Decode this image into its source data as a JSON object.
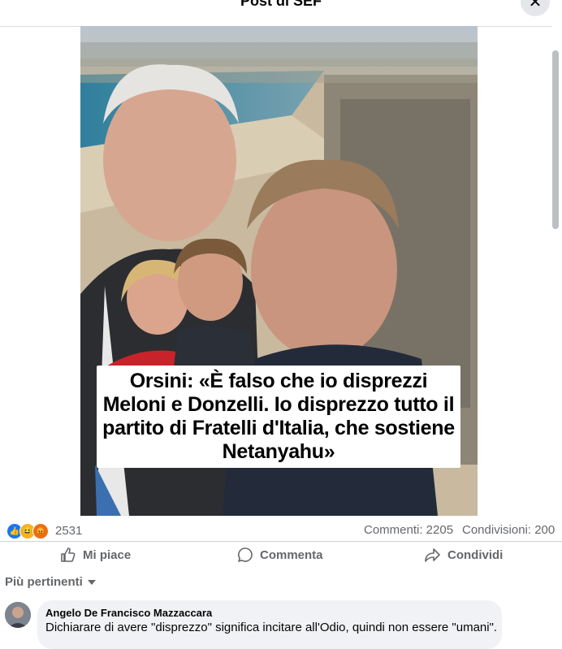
{
  "header": {
    "title": "Post di SEF"
  },
  "post": {
    "headline": "Orsini: «È falso che io disprezzi Meloni e Donzelli. Io disprezzo tutto il partito di Fratelli d'Italia, che sostiene Netanyahu»",
    "reactions": {
      "icons": [
        "like-icon",
        "haha-icon",
        "angry-icon"
      ],
      "count": "2531"
    },
    "comments_count": "Commenti: 2205",
    "shares_count": "Condivisioni: 200"
  },
  "actions": {
    "like": "Mi piace",
    "comment": "Commenta",
    "share": "Condividi"
  },
  "sort": {
    "label": "Più pertinenti"
  },
  "comment": {
    "author": "Angelo De Francisco Mazzaccara",
    "text": "Dichiarare di avere \"disprezzo\" significa incitare all'Odio, quindi non essere \"umani\"."
  },
  "colors": {
    "accent": "#1877f2",
    "muted": "#65676b",
    "bubble": "#f0f2f5"
  }
}
